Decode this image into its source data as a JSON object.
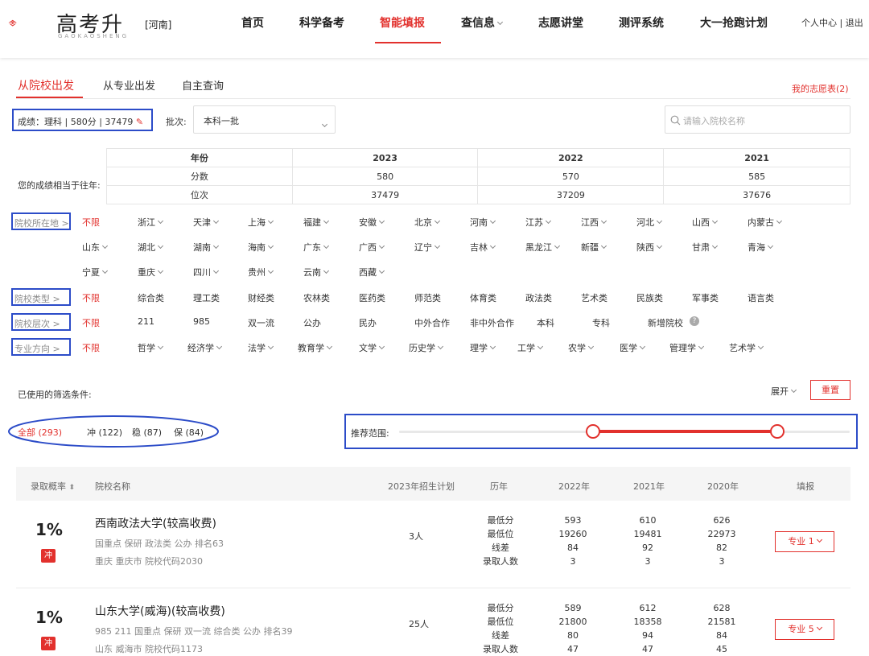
{
  "header": {
    "logo_text": "高考升",
    "logo_pinyin": "GAOKAOSHENG",
    "province": "[河南]",
    "nav": [
      "首页",
      "科学备考",
      "智能填报",
      "查信息",
      "志愿讲堂",
      "测评系统",
      "大一抢跑计划"
    ],
    "user": "个人中心 | 退出"
  },
  "tabs": [
    "从院校出发",
    "从专业出发",
    "自主查询"
  ],
  "my_list": "我的志愿表(2)",
  "score_text": "成绩：理科 | 580分 | 37479",
  "batch_label": "批次:",
  "batch_value": "本科一批",
  "search_placeholder": "请输入院校名称",
  "compare": {
    "label": "您的成绩相当于往年:",
    "rows": [
      [
        "年份",
        "2023",
        "2022",
        "2021"
      ],
      [
        "分数",
        "580",
        "570",
        "585"
      ],
      [
        "位次",
        "37479",
        "37209",
        "37676"
      ]
    ]
  },
  "filters": {
    "location_label": "院校所在地 >",
    "location_row1": [
      "不限",
      "浙江",
      "天津",
      "上海",
      "福建",
      "安徽",
      "北京",
      "河南",
      "江苏",
      "江西",
      "河北",
      "山西",
      "内蒙古"
    ],
    "location_row2": [
      "山东",
      "湖北",
      "湖南",
      "海南",
      "广东",
      "广西",
      "辽宁",
      "吉林",
      "黑龙江",
      "新疆",
      "陕西",
      "甘肃",
      "青海"
    ],
    "location_row3": [
      "宁夏",
      "重庆",
      "四川",
      "贵州",
      "云南",
      "西藏"
    ],
    "type_label": "院校类型 >",
    "types": [
      "不限",
      "综合类",
      "理工类",
      "财经类",
      "农林类",
      "医药类",
      "师范类",
      "体育类",
      "政法类",
      "艺术类",
      "民族类",
      "军事类",
      "语言类"
    ],
    "level_label": "院校层次 >",
    "levels": [
      "不限",
      "211",
      "985",
      "双一流",
      "公办",
      "民办",
      "中外合作",
      "非中外合作",
      "本科",
      "专科",
      "新增院校"
    ],
    "major_label": "专业方向 >",
    "majors": [
      "不限",
      "哲学",
      "经济学",
      "法学",
      "教育学",
      "文学",
      "历史学",
      "理学",
      "工学",
      "农学",
      "医学",
      "管理学",
      "艺术学"
    ]
  },
  "used_filters": "已使用的筛选条件:",
  "expand": "展开",
  "reset": "重置",
  "counts": {
    "all": "全部 (293)",
    "chong": "冲 (122)",
    "wen": "稳 (87)",
    "bao": "保 (84)"
  },
  "range_label": "推荐范围:",
  "range": {
    "low": 0.43,
    "high": 0.84
  },
  "colors": {
    "accent": "#e2312d",
    "annotation": "#2c4cc8"
  },
  "table_headers": [
    "录取概率",
    "院校名称",
    "2023年招生计划",
    "历年",
    "2022年",
    "2021年",
    "2020年",
    "填报"
  ],
  "stat_labels": [
    "最低分",
    "最低位",
    "线差",
    "录取人数"
  ],
  "schools": [
    {
      "prob": "1%",
      "tag": "冲",
      "name": "西南政法大学(较高收费)",
      "tags": "国重点 保研 政法类 公办 排名63",
      "loc": "重庆 重庆市 院校代码2030",
      "plan": "3人",
      "y2022": [
        "593",
        "19260",
        "84",
        "3"
      ],
      "y2021": [
        "610",
        "19481",
        "92",
        "3"
      ],
      "y2020": [
        "626",
        "22973",
        "82",
        "3"
      ],
      "btn": "专业 1"
    },
    {
      "prob": "1%",
      "tag": "冲",
      "name": "山东大学(威海)(较高收费)",
      "tags": "985 211 国重点 保研 双一流 综合类 公办 排名39",
      "loc": "山东 威海市 院校代码1173",
      "plan": "25人",
      "y2022": [
        "589",
        "21800",
        "80",
        "47"
      ],
      "y2021": [
        "612",
        "18358",
        "94",
        "47"
      ],
      "y2020": [
        "628",
        "21581",
        "84",
        "45"
      ],
      "btn": "专业 5"
    }
  ]
}
